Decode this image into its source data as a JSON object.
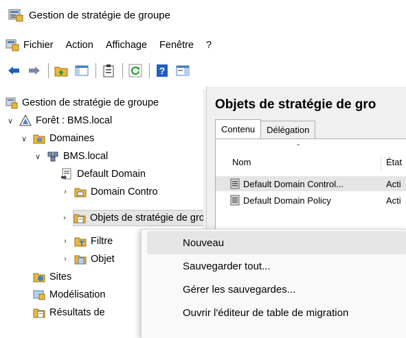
{
  "window": {
    "title": "Gestion de stratégie de groupe"
  },
  "menubar": {
    "items": [
      "Fichier",
      "Action",
      "Affichage",
      "Fenêtre",
      "?"
    ]
  },
  "tree": {
    "root": "Gestion de stratégie de groupe",
    "forest": "Forêt : BMS.local",
    "domains": "Domaines",
    "domain": "BMS.local",
    "default_domain": "Default Domain",
    "domain_controllers": "Domain Contro",
    "gpo_objects": "Objets de stratégie de groupe",
    "filters": "Filtre",
    "starter_gpo": "Objet",
    "sites": "Sites",
    "modeling": "Modélisation",
    "results": "Résultats de"
  },
  "right_pane": {
    "title": "Objets de stratégie de gro",
    "tabs": [
      "Contenu",
      "Délégation"
    ],
    "columns": {
      "name": "Nom",
      "state": "État"
    },
    "rows": [
      {
        "name": "Default Domain Control...",
        "state": "Acti"
      },
      {
        "name": "Default Domain Policy",
        "state": "Acti"
      }
    ]
  },
  "context_menu": {
    "items": [
      "Nouveau",
      "Sauvegarder tout...",
      "Gérer les sauvegardes...",
      "Ouvrir l'éditeur de table de migration"
    ]
  },
  "colors": {
    "folder": "#e8b840",
    "selection": "#e5e5e5",
    "toolbar_blue": "#1f5fbf",
    "refresh_green": "#2d9b3a"
  }
}
